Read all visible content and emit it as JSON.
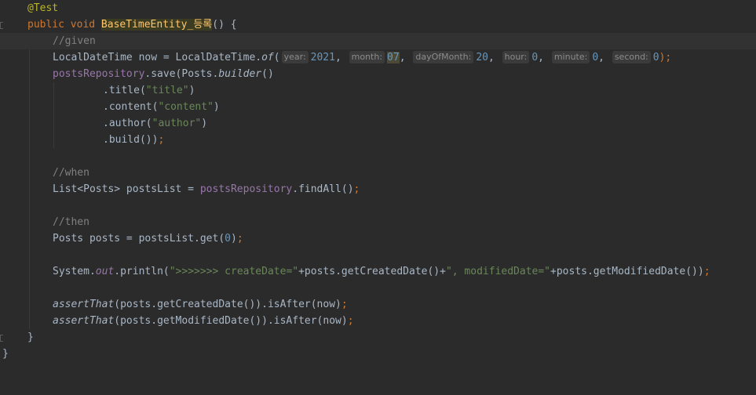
{
  "editor": {
    "annotation": "@Test",
    "method_kw": "public void ",
    "method_name": "BaseTimeEntity_등록",
    "method_tail": "() {",
    "given_comment": "//given",
    "line_now": {
      "p1": "LocalDateTime now = LocalDateTime.",
      "of": "of",
      "p2": "(",
      "hint_year": "year:",
      "year": "2021",
      "hint_month": "month:",
      "month": "07",
      "hint_day": "dayOfMonth:",
      "day": "20",
      "hint_hour": "hour:",
      "hour": "0",
      "hint_minute": "minute:",
      "minute": "0",
      "hint_second": "second:",
      "second": "0",
      "end": ");",
      "comma": ", "
    },
    "line_save": {
      "field": "postsRepository",
      "p1": ".save(Posts.",
      "builder": "builder",
      "p2": "()"
    },
    "line_title": {
      "p1": ".title(",
      "str": "\"title\"",
      "p2": ")"
    },
    "line_content": {
      "p1": ".content(",
      "str": "\"content\"",
      "p2": ")"
    },
    "line_author": {
      "p1": ".author(",
      "str": "\"author\"",
      "p2": ")"
    },
    "line_build": {
      "p1": ".build())",
      "semi": ";"
    },
    "when_comment": "//when",
    "line_findall": {
      "p1": "List<Posts> postsList = ",
      "field": "postsRepository",
      "p2": ".findAll()",
      "semi": ";"
    },
    "then_comment": "//then",
    "line_get": {
      "p1": "Posts posts = postsList.get(",
      "num": "0",
      "p2": ")",
      "semi": ";"
    },
    "line_println": {
      "p1": "System.",
      "out": "out",
      "p2": ".println(",
      "str1": "\">>>>>>> createDate=\"",
      "p3": "+posts.getCreatedDate()+",
      "str2": "\", modifiedDate=\"",
      "p4": "+posts.getModifiedDate())",
      "semi": ";"
    },
    "line_assert1": {
      "fn": "assertThat",
      "p1": "(posts.getCreatedDate()).isAfter(now)",
      "semi": ";"
    },
    "line_assert2": {
      "fn": "assertThat",
      "p1": "(posts.getModifiedDate()).isAfter(now)",
      "semi": ";"
    },
    "close_method": "}",
    "close_class": "}"
  }
}
